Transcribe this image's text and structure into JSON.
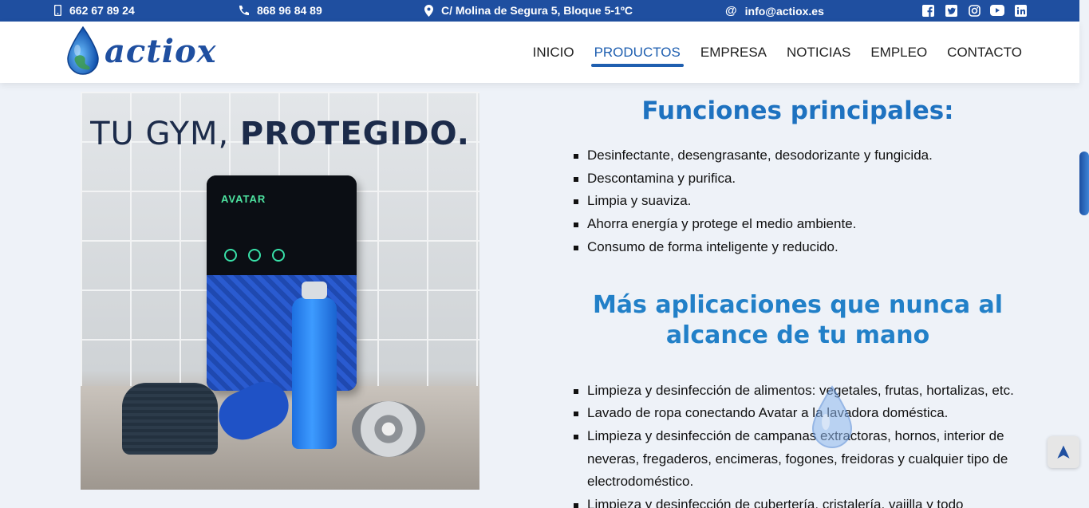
{
  "topbar": {
    "mobile_phone": "662 67 89 24",
    "landline_phone": "868 96 84 89",
    "address": "C/ Molina de Segura 5, Bloque 5-1ºC",
    "email": "info@actiox.es",
    "social": [
      "facebook-icon",
      "twitter-icon",
      "instagram-icon",
      "youtube-icon",
      "linkedin-icon"
    ]
  },
  "header": {
    "logo_text": "actiox",
    "nav": [
      "INICIO",
      "PRODUCTOS",
      "EMPRESA",
      "NOTICIAS",
      "EMPLEO",
      "CONTACTO"
    ],
    "active_nav": "PRODUCTOS"
  },
  "hero_image": {
    "title_light": "TU GYM, ",
    "title_bold": "PROTEGIDO.",
    "device_brand": "AVATAR"
  },
  "main": {
    "functions_title": "Funciones principales:",
    "functions": [
      "Desinfectante, desengrasante, desodorizante y fungicida.",
      "Descontamina y purifica.",
      "Limpia y suaviza.",
      "Ahorra energía y protege el medio ambiente.",
      "Consumo de forma inteligente y reducido."
    ],
    "apps_title": "Más aplicaciones que nunca al alcance de tu mano",
    "apps": [
      "Limpieza y desinfección de alimentos: vegetales, frutas, hortalizas, etc.",
      "Lavado de ropa conectando Avatar a la lavadora doméstica.",
      "Limpieza y desinfección de campanas extractoras, hornos, interior de neveras, fregaderos, encimeras, fogones, freidoras y cualquier tipo de electrodoméstico.",
      "Limpieza y desinfección de cubertería, cristalería, vajilla y todo"
    ]
  },
  "colors": {
    "topbar": "#1f4fa0",
    "heading": "#1e72c0",
    "nav_active": "#1f5fb0"
  }
}
